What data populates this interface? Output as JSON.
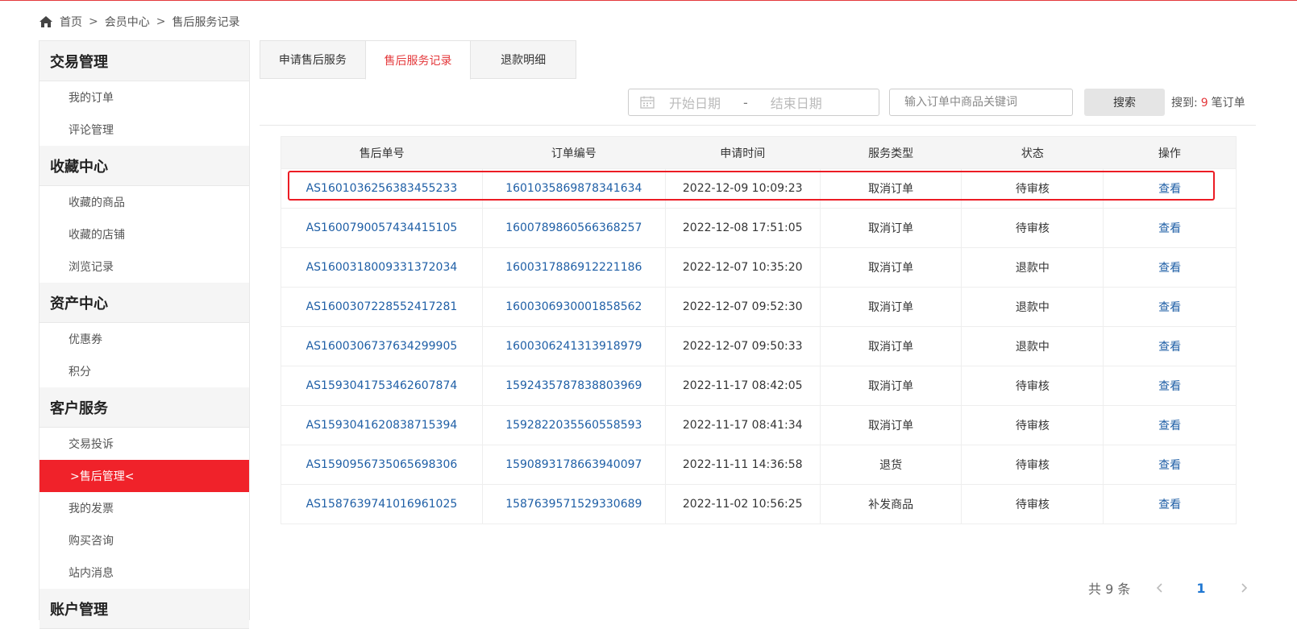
{
  "breadcrumb": {
    "home": "首页",
    "member": "会员中心",
    "current": "售后服务记录",
    "separator": ">"
  },
  "sidebar": {
    "groups": [
      {
        "title": "交易管理",
        "items": [
          "我的订单",
          "评论管理"
        ]
      },
      {
        "title": "收藏中心",
        "items": [
          "收藏的商品",
          "收藏的店铺",
          "浏览记录"
        ]
      },
      {
        "title": "资产中心",
        "items": [
          "优惠券",
          "积分"
        ]
      },
      {
        "title": "客户服务",
        "items": [
          "交易投诉",
          ">售后管理<",
          "我的发票",
          "购买咨询",
          "站内消息"
        ]
      },
      {
        "title": "账户管理",
        "items": []
      }
    ],
    "active_item": ">售后管理<",
    "active_color": "#f0222a"
  },
  "tabs": [
    {
      "label": "申请售后服务",
      "active": false
    },
    {
      "label": "售后服务记录",
      "active": true
    },
    {
      "label": "退款明细",
      "active": false
    }
  ],
  "filter": {
    "start_placeholder": "开始日期",
    "date_separator": "-",
    "end_placeholder": "结束日期",
    "keyword_placeholder": "输入订单中商品关键词",
    "search_label": "搜索",
    "result_prefix": "搜到:",
    "result_count": "9",
    "result_suffix": "笔订单"
  },
  "table": {
    "headers": [
      "售后单号",
      "订单编号",
      "申请时间",
      "服务类型",
      "状态",
      "操作"
    ],
    "rows": [
      {
        "after_sale_no": "AS1601036256383455233",
        "order_no": "1601035869878341634",
        "time": "2022-12-09 10:09:23",
        "type": "取消订单",
        "status": "待审核",
        "action": "查看"
      },
      {
        "after_sale_no": "AS1600790057434415105",
        "order_no": "1600789860566368257",
        "time": "2022-12-08 17:51:05",
        "type": "取消订单",
        "status": "待审核",
        "action": "查看"
      },
      {
        "after_sale_no": "AS1600318009331372034",
        "order_no": "1600317886912221186",
        "time": "2022-12-07 10:35:20",
        "type": "取消订单",
        "status": "退款中",
        "action": "查看"
      },
      {
        "after_sale_no": "AS1600307228552417281",
        "order_no": "1600306930001858562",
        "time": "2022-12-07 09:52:30",
        "type": "取消订单",
        "status": "退款中",
        "action": "查看"
      },
      {
        "after_sale_no": "AS1600306737634299905",
        "order_no": "1600306241313918979",
        "time": "2022-12-07 09:50:33",
        "type": "取消订单",
        "status": "退款中",
        "action": "查看"
      },
      {
        "after_sale_no": "AS1593041753462607874",
        "order_no": "1592435787838803969",
        "time": "2022-11-17 08:42:05",
        "type": "取消订单",
        "status": "待审核",
        "action": "查看"
      },
      {
        "after_sale_no": "AS1593041620838715394",
        "order_no": "1592822035560558593",
        "time": "2022-11-17 08:41:34",
        "type": "取消订单",
        "status": "待审核",
        "action": "查看"
      },
      {
        "after_sale_no": "AS1590956735065698306",
        "order_no": "1590893178663940097",
        "time": "2022-11-11 14:36:58",
        "type": "退货",
        "status": "待审核",
        "action": "查看"
      },
      {
        "after_sale_no": "AS1587639741016961025",
        "order_no": "1587639571529330689",
        "time": "2022-11-02 10:56:25",
        "type": "补发商品",
        "status": "待审核",
        "action": "查看"
      }
    ]
  },
  "pagination": {
    "total": "共 9 条",
    "current_page": "1"
  },
  "colors": {
    "accent": "#e4393c",
    "link": "#1f5fa6",
    "highlight_box": "#ec1c24"
  }
}
